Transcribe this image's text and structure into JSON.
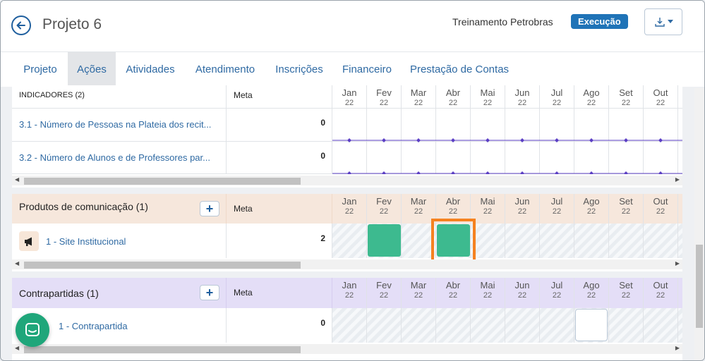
{
  "header": {
    "back_icon": "arrow-left-icon",
    "title": "Projeto 6",
    "org": "Treinamento Petrobras",
    "status": "Execução",
    "export_icon": "download-dropdown-icon"
  },
  "tabs": [
    {
      "label": "Projeto",
      "active": false
    },
    {
      "label": "Ações",
      "active": true
    },
    {
      "label": "Atividades",
      "active": false
    },
    {
      "label": "Atendimento",
      "active": false
    },
    {
      "label": "Inscrições",
      "active": false
    },
    {
      "label": "Financeiro",
      "active": false
    },
    {
      "label": "Prestação de Contas",
      "active": false
    }
  ],
  "months": [
    {
      "m": "Jan",
      "y": "22"
    },
    {
      "m": "Fev",
      "y": "22"
    },
    {
      "m": "Mar",
      "y": "22"
    },
    {
      "m": "Abr",
      "y": "22"
    },
    {
      "m": "Mai",
      "y": "22"
    },
    {
      "m": "Jun",
      "y": "22"
    },
    {
      "m": "Jul",
      "y": "22"
    },
    {
      "m": "Ago",
      "y": "22"
    },
    {
      "m": "Set",
      "y": "22"
    },
    {
      "m": "Out",
      "y": "22"
    }
  ],
  "indicadores": {
    "header": "INDICADORES (2)",
    "meta_label": "Meta",
    "rows": [
      {
        "label": "3.1 - Número de Pessoas na Plateia dos recit...",
        "meta": "0"
      },
      {
        "label": "3.2 - Número de Alunos e de Professores par...",
        "meta": "0"
      }
    ]
  },
  "produtos": {
    "title": "Produtos de comunicação (1)",
    "meta_label": "Meta",
    "add": "+",
    "row": {
      "label": "1 - Site Institucional",
      "meta": "2",
      "icon": "megaphone-icon"
    },
    "filled_months": [
      "Fev",
      "Abr"
    ],
    "highlight_month": "Abr"
  },
  "contrapartidas": {
    "title": "Contrapartidas (1)",
    "meta_label": "Meta",
    "add": "+",
    "row": {
      "label": "1 - Contrapartida",
      "meta": "0"
    },
    "empty_box_month": "Ago"
  },
  "colors": {
    "primary": "#1f73b7",
    "produtos_header": "#f6e7dc",
    "contrapartidas_header": "#e4def7",
    "filled": "#3dba8f",
    "highlight": "#f58220",
    "chat": "#1fa67a",
    "sparkline": "#5b3fc4"
  },
  "chat_icon": "chat-bubble-icon"
}
